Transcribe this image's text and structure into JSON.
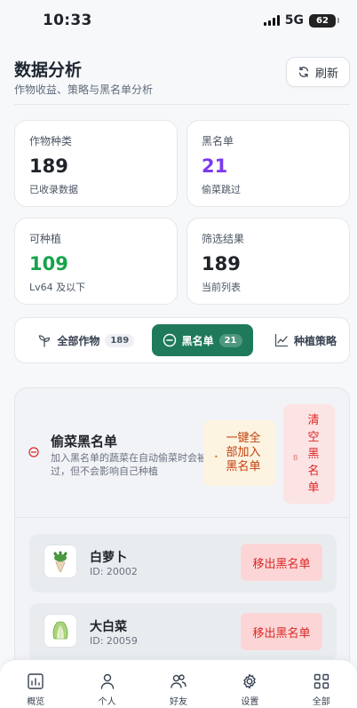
{
  "status_bar": {
    "time": "10:33",
    "network": "5G",
    "battery": "62"
  },
  "header": {
    "title": "数据分析",
    "subtitle": "作物收益、策略与黑名单分析",
    "refresh_label": "刷新"
  },
  "stats": [
    {
      "label": "作物种类",
      "value": "189",
      "hint": "已收录数据"
    },
    {
      "label": "黑名单",
      "value": "21",
      "hint": "偷菜跳过",
      "color": "#7c3aed"
    },
    {
      "label": "可种植",
      "value": "109",
      "hint": "Lv64 及以下",
      "color": "#16a34a"
    },
    {
      "label": "筛选结果",
      "value": "189",
      "hint": "当前列表"
    }
  ],
  "tabs": [
    {
      "label": "全部作物",
      "count": "189",
      "icon": "sprout-icon"
    },
    {
      "label": "黑名单",
      "count": "21",
      "icon": "minus-circle-icon",
      "active": true
    },
    {
      "label": "种植策略",
      "icon": "line-chart-icon"
    }
  ],
  "blacklist": {
    "title": "偷菜黑名单",
    "description": "加入黑名单的蔬菜在自动偷菜时会被跳过，但不会影响自己种植",
    "add_all_label": "一键全部加入黑名单",
    "clear_label": "清空黑名单",
    "clear_marker": "B",
    "items": [
      {
        "name": "白萝卜",
        "id": "ID: 20002",
        "action": "移出黑名单",
        "icon": "radish-icon"
      },
      {
        "name": "大白菜",
        "id": "ID: 20059",
        "action": "移出黑名单",
        "icon": "cabbage-icon"
      }
    ]
  },
  "bottom_nav": [
    {
      "label": "概览",
      "icon": "overview-icon"
    },
    {
      "label": "个人",
      "icon": "person-icon"
    },
    {
      "label": "好友",
      "icon": "friends-icon"
    },
    {
      "label": "设置",
      "icon": "gear-icon"
    },
    {
      "label": "全部",
      "icon": "grid-icon"
    }
  ],
  "accent_color": "#1f7a5c"
}
